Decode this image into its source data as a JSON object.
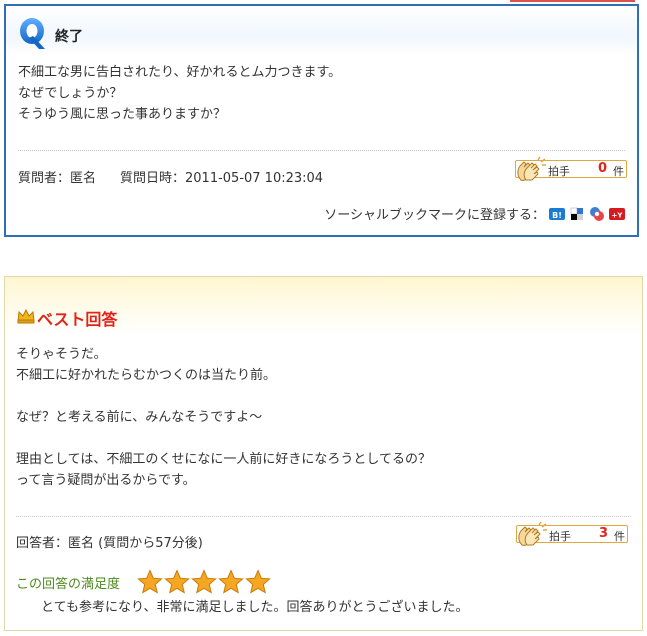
{
  "question": {
    "icon": "q-icon",
    "status": "終了",
    "lines": [
      "不細工な男に告白されたり、好かれるとム力つきます。",
      "なぜでしょうか？",
      "そうゆう風に思った事ありますか？"
    ],
    "asker_label": "質問者：匿名",
    "date_label": "質問日時：2011-05-07 10:23:04",
    "clap": {
      "label": "拍手",
      "count": "0",
      "unit": "件"
    },
    "social": {
      "label": "ソーシャルブックマークに登録する：",
      "icons": [
        "hatena-bookmark-icon",
        "delicious-icon",
        "livedoor-clip-icon",
        "yahoo-bookmark-icon"
      ]
    }
  },
  "answer": {
    "badge_icon": "crown-icon",
    "badge": "ベスト回答",
    "lines": [
      "そりゃそうだ。",
      "不細工に好かれたらむかつくのは当たり前。",
      "",
      "なぜ？と考える前に、みんなそうですよ～",
      "",
      "理由としては、不細工のくせになに一人前に好きになろうとしてるの？",
      "って言う疑問が出るからです。"
    ],
    "answerer_label": "回答者：匿名 (質問から57分後)",
    "clap": {
      "label": "拍手",
      "count": "3",
      "unit": "件"
    },
    "satisfaction_label": "この回答の満足度",
    "rating": 5,
    "rating_max": 5,
    "satisfaction_comment": "とても参考になり、非常に満足しました。回答ありがとうございました。"
  },
  "colors": {
    "question_border": "#2f6fb5",
    "best_red": "#e2231a",
    "satisfaction_green": "#4d8a1f",
    "star_orange": "#f5a623"
  }
}
